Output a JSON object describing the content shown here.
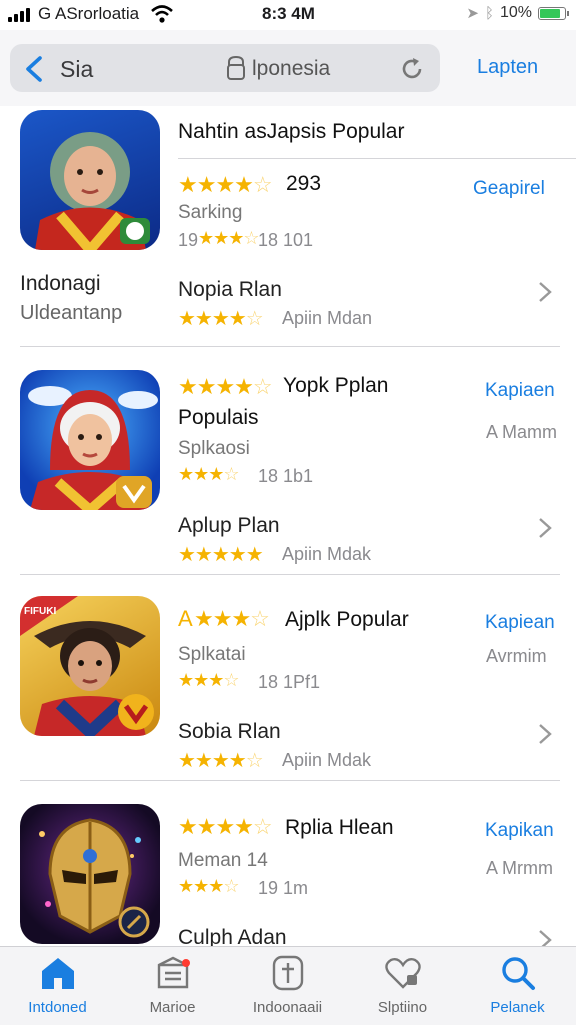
{
  "status_bar": {
    "carrier": "G ASrorloatia",
    "time": "8:3 4M",
    "battery": "10%",
    "battery_color": "#34c759"
  },
  "nav": {
    "back_label": "Sia",
    "url": "lponesia",
    "action_label": "Lapten"
  },
  "colors": {
    "accent": "#1a7ee0",
    "star": "#f5b301",
    "badge": "#ff3b30"
  },
  "apps": [
    {
      "icon": "hijab-girl-app-icon",
      "title": "Nahtin asJapsis Popular",
      "rating_text": "293",
      "link": "Geapirel",
      "sub": "Sarking",
      "small_rating": "19",
      "small_meta": "18 101",
      "left_title": "Indonagi",
      "left_sub": "Uldeantanp",
      "plan": "Nopia Rlan",
      "plan_meta": "Apiin Mdan"
    },
    {
      "icon": "veiled-girl-app-icon",
      "title": "Yopk Pplan",
      "title2": "Populais",
      "link": "Kapiaen",
      "right_gray": "A Mamm",
      "sub": "Splkaosi",
      "small_meta": "18 1b1",
      "plan": "Aplup Plan",
      "plan_meta": "Apiin Mdak"
    },
    {
      "icon": "hero-boy-app-icon",
      "title": "Ajplk Popular",
      "title_prefix": "A",
      "link": "Kapiean",
      "right_gray": "Avrmim",
      "sub": "Splkatai",
      "small_meta": "18 1Pf1",
      "plan": "Sobia Rlan",
      "plan_meta": "Apiin Mdak",
      "icon_banner": "FIFUKI"
    },
    {
      "icon": "golden-helmet-app-icon",
      "title": "Rplia Hlean",
      "link": "Kapikan",
      "right_gray": "A Mrmm",
      "sub": "Meman 14",
      "small_meta": "19 1m",
      "plan": "Culph Adan"
    }
  ],
  "tabs": [
    {
      "label": "Intdoned",
      "icon": "home-icon",
      "active": true
    },
    {
      "label": "Marioe",
      "icon": "store-icon",
      "active": false
    },
    {
      "label": "Indoonaaii",
      "icon": "dagger-icon",
      "active": false
    },
    {
      "label": "Slptiino",
      "icon": "heart-icon",
      "active": false
    },
    {
      "label": "Pelanek",
      "icon": "search-icon",
      "active": true
    }
  ]
}
